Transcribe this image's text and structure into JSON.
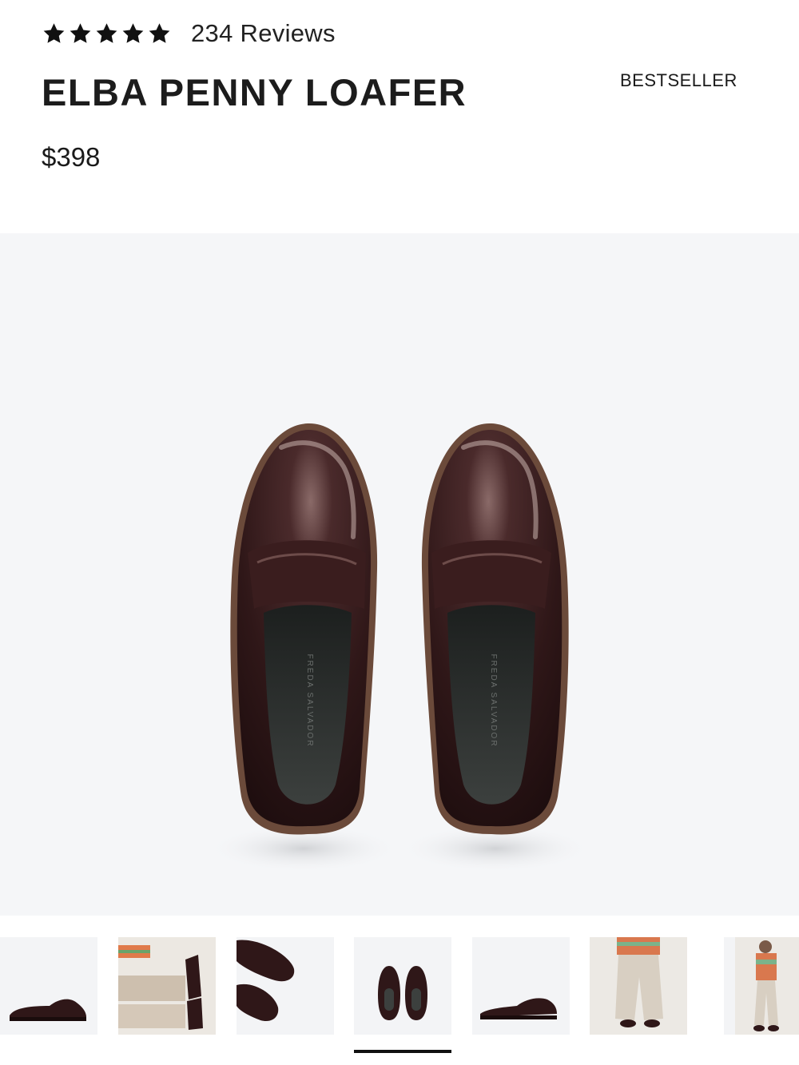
{
  "rating": {
    "stars": 5,
    "reviews_label": "234 Reviews"
  },
  "product": {
    "name": "ELBA PENNY LOAFER",
    "badge": "BESTSELLER",
    "price": "$398"
  },
  "hero_image": {
    "alt": "product-photo-top-view",
    "insole_text": "FREDA SALVADOR"
  },
  "gallery": {
    "count": 7,
    "selected_index": 3
  },
  "colors": {
    "leather": "#2f1718",
    "background": "#f5f6f8",
    "indicator": "#111111"
  }
}
